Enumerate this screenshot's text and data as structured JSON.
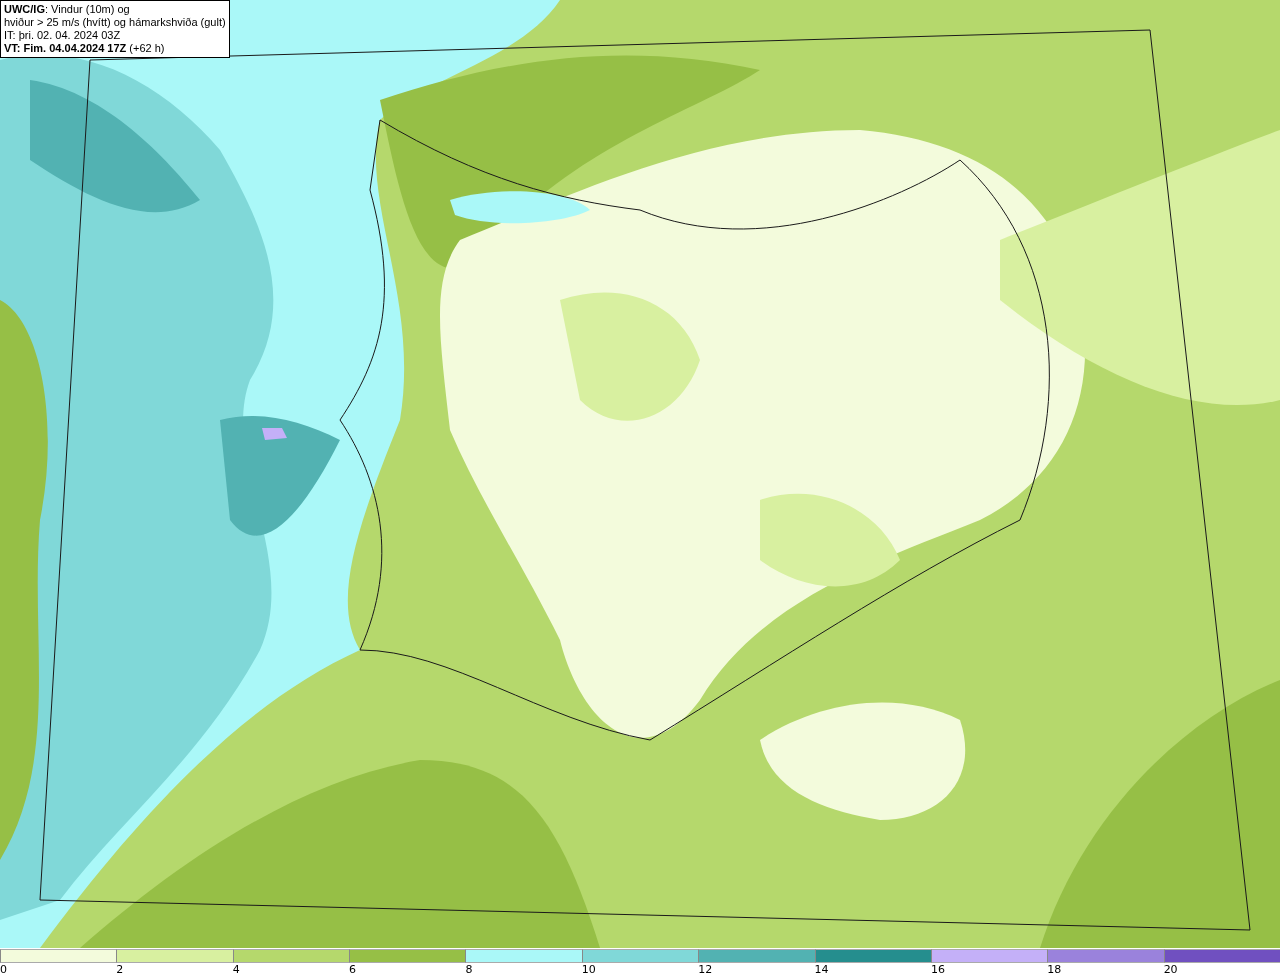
{
  "title_box": {
    "lines": [
      "**UWC/IG**: Vindur (10m) og",
      "hviður > 25 m/s (hvítt) og hámarkshviða (gult)",
      "IT: þri. 02. 04. 2024 03Z",
      "**VT: Fim. 04.04.2024 17Z** (+62 h)"
    ]
  },
  "legend": [
    {
      "label": "0",
      "color": "#f3fbdc"
    },
    {
      "label": "2",
      "color": "#d8f0a0"
    },
    {
      "label": "4",
      "color": "#b5d86c"
    },
    {
      "label": "6",
      "color": "#96bf46"
    },
    {
      "label": "8",
      "color": "#aaf8f8"
    },
    {
      "label": "10",
      "color": "#80d8d8"
    },
    {
      "label": "12",
      "color": "#52b2b2"
    },
    {
      "label": "14",
      "color": "#258e8e"
    },
    {
      "label": "16",
      "color": "#c4b0f8"
    },
    {
      "label": "18",
      "color": "#9a82dc"
    },
    {
      "label": "20",
      "color": "#7050c0"
    }
  ]
}
